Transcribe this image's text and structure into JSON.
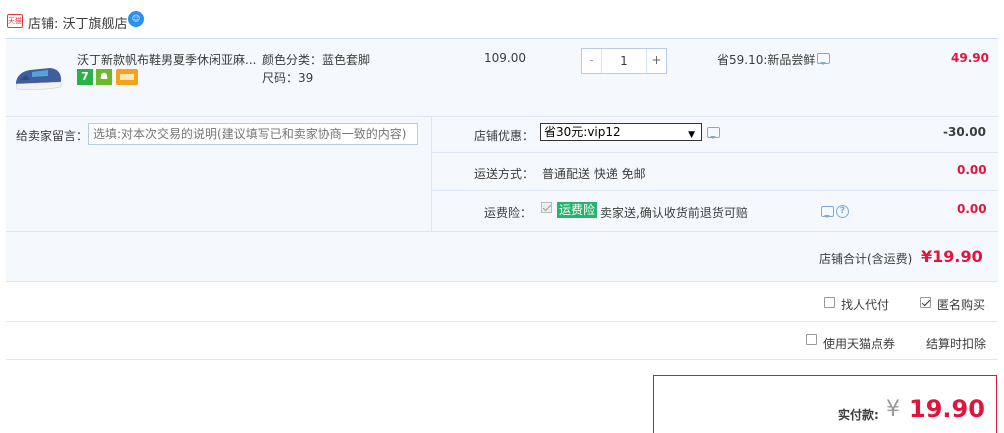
{
  "shop": {
    "badge": "天猫",
    "label": "店铺: 沃丁旗舰店"
  },
  "item": {
    "title": "沃丁新款帆布鞋男夏季休闲亚麻...",
    "color_sku": "颜色分类：蓝色套脚",
    "size_sku": "尺码：39",
    "price": "109.00",
    "qty": {
      "minus": "-",
      "value": "1",
      "plus": "+"
    },
    "promo": "省59.10:新品尝鲜",
    "total": "49.90",
    "service_badge_1": "7"
  },
  "memo": {
    "label": "给卖家留言：",
    "placeholder": "选填:对本次交易的说明(建议填写已和卖家协商一致的内容)"
  },
  "coupon": {
    "label": "店铺优惠：",
    "selected": "省30元:vip12",
    "amount": "-30.00"
  },
  "shipping": {
    "label": "运送方式：",
    "value": "普通配送 快递 免邮",
    "amount": "0.00"
  },
  "insurance": {
    "label": "运费险：",
    "tag": "运费险",
    "desc": "卖家送,确认收货前退货可赔",
    "amount": "0.00"
  },
  "subtotal": {
    "label": "店铺合计(含运费)",
    "value": "¥19.90"
  },
  "options": {
    "proxy_pay": "找人代付",
    "anonymous": "匿名购买",
    "tmall_points": "使用天猫点券",
    "deduct_note": "结算时扣除"
  },
  "payment": {
    "label": "实付款:",
    "currency": "¥",
    "value": "19.90"
  },
  "colors": {
    "price_red": "#e0143c",
    "panel_bg": "#f5f8fd",
    "border_blue": "#b6cbe6",
    "insurance_green": "#26b36b"
  }
}
